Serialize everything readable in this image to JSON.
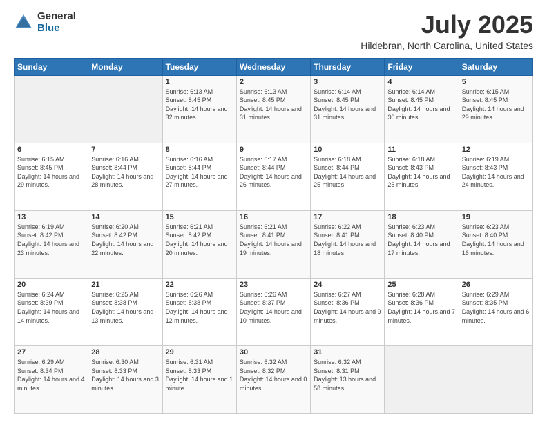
{
  "logo": {
    "general": "General",
    "blue": "Blue"
  },
  "title": "July 2025",
  "location": "Hildebran, North Carolina, United States",
  "days_of_week": [
    "Sunday",
    "Monday",
    "Tuesday",
    "Wednesday",
    "Thursday",
    "Friday",
    "Saturday"
  ],
  "weeks": [
    [
      {
        "day": "",
        "sunrise": "",
        "sunset": "",
        "daylight": ""
      },
      {
        "day": "",
        "sunrise": "",
        "sunset": "",
        "daylight": ""
      },
      {
        "day": "1",
        "sunrise": "Sunrise: 6:13 AM",
        "sunset": "Sunset: 8:45 PM",
        "daylight": "Daylight: 14 hours and 32 minutes."
      },
      {
        "day": "2",
        "sunrise": "Sunrise: 6:13 AM",
        "sunset": "Sunset: 8:45 PM",
        "daylight": "Daylight: 14 hours and 31 minutes."
      },
      {
        "day": "3",
        "sunrise": "Sunrise: 6:14 AM",
        "sunset": "Sunset: 8:45 PM",
        "daylight": "Daylight: 14 hours and 31 minutes."
      },
      {
        "day": "4",
        "sunrise": "Sunrise: 6:14 AM",
        "sunset": "Sunset: 8:45 PM",
        "daylight": "Daylight: 14 hours and 30 minutes."
      },
      {
        "day": "5",
        "sunrise": "Sunrise: 6:15 AM",
        "sunset": "Sunset: 8:45 PM",
        "daylight": "Daylight: 14 hours and 29 minutes."
      }
    ],
    [
      {
        "day": "6",
        "sunrise": "Sunrise: 6:15 AM",
        "sunset": "Sunset: 8:45 PM",
        "daylight": "Daylight: 14 hours and 29 minutes."
      },
      {
        "day": "7",
        "sunrise": "Sunrise: 6:16 AM",
        "sunset": "Sunset: 8:44 PM",
        "daylight": "Daylight: 14 hours and 28 minutes."
      },
      {
        "day": "8",
        "sunrise": "Sunrise: 6:16 AM",
        "sunset": "Sunset: 8:44 PM",
        "daylight": "Daylight: 14 hours and 27 minutes."
      },
      {
        "day": "9",
        "sunrise": "Sunrise: 6:17 AM",
        "sunset": "Sunset: 8:44 PM",
        "daylight": "Daylight: 14 hours and 26 minutes."
      },
      {
        "day": "10",
        "sunrise": "Sunrise: 6:18 AM",
        "sunset": "Sunset: 8:44 PM",
        "daylight": "Daylight: 14 hours and 25 minutes."
      },
      {
        "day": "11",
        "sunrise": "Sunrise: 6:18 AM",
        "sunset": "Sunset: 8:43 PM",
        "daylight": "Daylight: 14 hours and 25 minutes."
      },
      {
        "day": "12",
        "sunrise": "Sunrise: 6:19 AM",
        "sunset": "Sunset: 8:43 PM",
        "daylight": "Daylight: 14 hours and 24 minutes."
      }
    ],
    [
      {
        "day": "13",
        "sunrise": "Sunrise: 6:19 AM",
        "sunset": "Sunset: 8:42 PM",
        "daylight": "Daylight: 14 hours and 23 minutes."
      },
      {
        "day": "14",
        "sunrise": "Sunrise: 6:20 AM",
        "sunset": "Sunset: 8:42 PM",
        "daylight": "Daylight: 14 hours and 22 minutes."
      },
      {
        "day": "15",
        "sunrise": "Sunrise: 6:21 AM",
        "sunset": "Sunset: 8:42 PM",
        "daylight": "Daylight: 14 hours and 20 minutes."
      },
      {
        "day": "16",
        "sunrise": "Sunrise: 6:21 AM",
        "sunset": "Sunset: 8:41 PM",
        "daylight": "Daylight: 14 hours and 19 minutes."
      },
      {
        "day": "17",
        "sunrise": "Sunrise: 6:22 AM",
        "sunset": "Sunset: 8:41 PM",
        "daylight": "Daylight: 14 hours and 18 minutes."
      },
      {
        "day": "18",
        "sunrise": "Sunrise: 6:23 AM",
        "sunset": "Sunset: 8:40 PM",
        "daylight": "Daylight: 14 hours and 17 minutes."
      },
      {
        "day": "19",
        "sunrise": "Sunrise: 6:23 AM",
        "sunset": "Sunset: 8:40 PM",
        "daylight": "Daylight: 14 hours and 16 minutes."
      }
    ],
    [
      {
        "day": "20",
        "sunrise": "Sunrise: 6:24 AM",
        "sunset": "Sunset: 8:39 PM",
        "daylight": "Daylight: 14 hours and 14 minutes."
      },
      {
        "day": "21",
        "sunrise": "Sunrise: 6:25 AM",
        "sunset": "Sunset: 8:38 PM",
        "daylight": "Daylight: 14 hours and 13 minutes."
      },
      {
        "day": "22",
        "sunrise": "Sunrise: 6:26 AM",
        "sunset": "Sunset: 8:38 PM",
        "daylight": "Daylight: 14 hours and 12 minutes."
      },
      {
        "day": "23",
        "sunrise": "Sunrise: 6:26 AM",
        "sunset": "Sunset: 8:37 PM",
        "daylight": "Daylight: 14 hours and 10 minutes."
      },
      {
        "day": "24",
        "sunrise": "Sunrise: 6:27 AM",
        "sunset": "Sunset: 8:36 PM",
        "daylight": "Daylight: 14 hours and 9 minutes."
      },
      {
        "day": "25",
        "sunrise": "Sunrise: 6:28 AM",
        "sunset": "Sunset: 8:36 PM",
        "daylight": "Daylight: 14 hours and 7 minutes."
      },
      {
        "day": "26",
        "sunrise": "Sunrise: 6:29 AM",
        "sunset": "Sunset: 8:35 PM",
        "daylight": "Daylight: 14 hours and 6 minutes."
      }
    ],
    [
      {
        "day": "27",
        "sunrise": "Sunrise: 6:29 AM",
        "sunset": "Sunset: 8:34 PM",
        "daylight": "Daylight: 14 hours and 4 minutes."
      },
      {
        "day": "28",
        "sunrise": "Sunrise: 6:30 AM",
        "sunset": "Sunset: 8:33 PM",
        "daylight": "Daylight: 14 hours and 3 minutes."
      },
      {
        "day": "29",
        "sunrise": "Sunrise: 6:31 AM",
        "sunset": "Sunset: 8:33 PM",
        "daylight": "Daylight: 14 hours and 1 minute."
      },
      {
        "day": "30",
        "sunrise": "Sunrise: 6:32 AM",
        "sunset": "Sunset: 8:32 PM",
        "daylight": "Daylight: 14 hours and 0 minutes."
      },
      {
        "day": "31",
        "sunrise": "Sunrise: 6:32 AM",
        "sunset": "Sunset: 8:31 PM",
        "daylight": "Daylight: 13 hours and 58 minutes."
      },
      {
        "day": "",
        "sunrise": "",
        "sunset": "",
        "daylight": ""
      },
      {
        "day": "",
        "sunrise": "",
        "sunset": "",
        "daylight": ""
      }
    ]
  ]
}
